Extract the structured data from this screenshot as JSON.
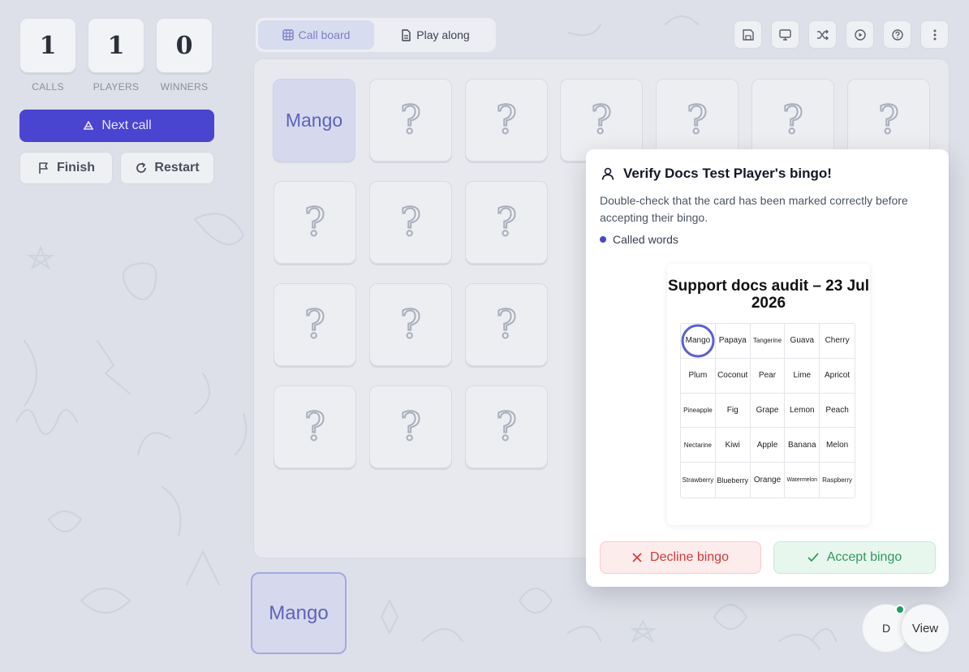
{
  "stats": [
    {
      "value": "1",
      "label": "CALLS"
    },
    {
      "value": "1",
      "label": "PLAYERS"
    },
    {
      "value": "0",
      "label": "WINNERS"
    }
  ],
  "controls": {
    "next_call": "Next call",
    "finish": "Finish",
    "restart": "Restart"
  },
  "tabs": [
    {
      "label": "Call board",
      "active": true
    },
    {
      "label": "Play along",
      "active": false
    }
  ],
  "toolbar_icons": [
    "save-icon",
    "monitor-icon",
    "shuffle-icon",
    "record-icon",
    "help-icon",
    "more-vertical-icon"
  ],
  "board": {
    "called_word": "Mango",
    "hidden_glyph": "?",
    "last_called": "Mango"
  },
  "modal": {
    "title": "Verify Docs Test Player's bingo!",
    "description": "Double-check that the card has been marked correctly before accepting their bingo.",
    "legend_label": "Called words",
    "card_title": "Support docs audit – 23 Jul 2026",
    "card_cells": [
      "Mango",
      "Papaya",
      "Tangerine",
      "Guava",
      "Cherry",
      "Plum",
      "Coconut",
      "Pear",
      "Lime",
      "Apricot",
      "Pineapple",
      "Fig",
      "Grape",
      "Lemon",
      "Peach",
      "Nectarine",
      "Kiwi",
      "Apple",
      "Banana",
      "Melon",
      "Strawberry",
      "Blueberry",
      "Orange",
      "Watermelon",
      "Raspberry"
    ],
    "marked": [
      "Mango"
    ],
    "decline_label": "Decline bingo",
    "accept_label": "Accept bingo"
  },
  "user": {
    "initial": "D",
    "view_label": "View"
  },
  "colors": {
    "primary": "#4a45d0",
    "decline": "#d03a3a",
    "accept": "#2f9a5a",
    "online": "#1f9d63"
  }
}
